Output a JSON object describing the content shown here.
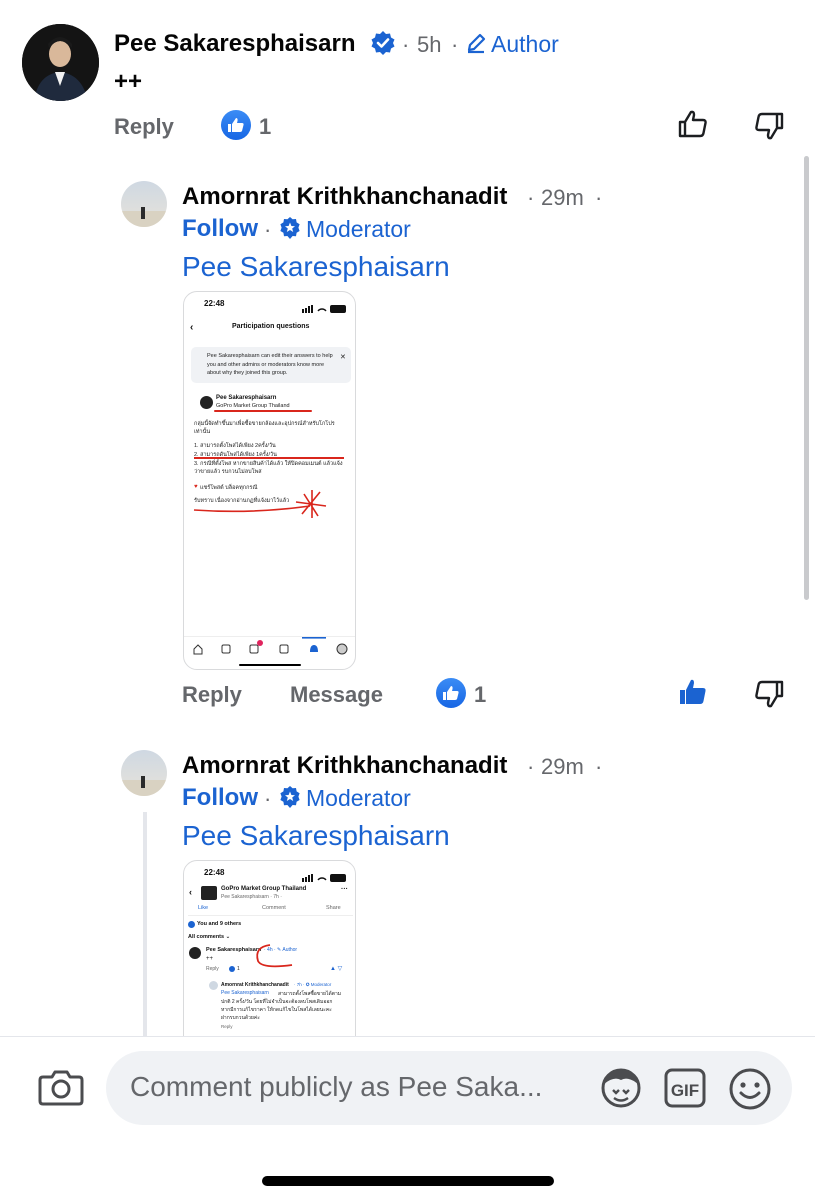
{
  "colors": {
    "accent": "#1b63d1",
    "muted": "#65676b",
    "like_gradient": "#1766e4"
  },
  "comment1": {
    "author": "Pee Sakaresphaisarn",
    "verified_icon": "verified-badge-icon",
    "time": "5h",
    "role": "Author",
    "text": "++",
    "reply_label": "Reply",
    "like_count": "1"
  },
  "reply1": {
    "author": "Amornrat Krithkhanchanadit",
    "time": "29m",
    "follow_label": "Follow",
    "role": "Moderator",
    "mention": "Pee Sakaresphaisarn",
    "reply_label": "Reply",
    "message_label": "Message",
    "like_count": "1",
    "screenshot": {
      "time": "22:48",
      "battery": "100",
      "title": "Participation questions",
      "notice": "Pee Sakaresphaisarn can edit their answers to help you and other admins or moderators know more about why they joined this group.",
      "member_name": "Pee Sakaresphaisarn",
      "member_group": "GoPro Market  Group Thailand",
      "rules_intro": "กลุ่มนี้จัดทำขึ้นมาเพื่อซื้อขายกล้องและอุปกรณ์สำหรับโกโปร เท่านั้น",
      "rule1": "1. สามารถตั้งโพสได้เพียง 2ครั้ง/วัน",
      "rule2": "2. สามารถดันโพสได้เพียง 1ครั้ง/วัน",
      "rule3": "3. กรณีที่ตั้งโพส หากขายสินค้าได้แล้ว ให้ปิดคอมเมนต์ แล้วแจ้งว่าขายแล้ว รบกวนไม่ลบโพส",
      "heart_line": "แชร์โพสต์ บล็อคทุกกรณี",
      "answer": "รับทราบ เนื่องจากอ่านกฏที่แจ้งมาไว้แล้ว",
      "nav_badge": "2"
    }
  },
  "reply2": {
    "author": "Amornrat Krithkhanchanadit",
    "time": "29m",
    "follow_label": "Follow",
    "role": "Moderator",
    "mention": "Pee Sakaresphaisarn",
    "screenshot": {
      "time": "22:48",
      "battery": "100",
      "group_name": "GoPro Market  Group Thailand",
      "group_sub": "Pee Sakaresphaisarn · 7h ·",
      "like": "Like",
      "comment": "Comment",
      "share": "Share",
      "reactions": "You and 9 others",
      "all_comments": "All comments ⌄",
      "c_author": "Pee Sakaresphaisarn",
      "c_meta": "· 4h · ✎ Author",
      "c_text": "++",
      "c_reply": "Reply",
      "c_likes": "1",
      "r_author": "Amornrat Krithkhanchanadit",
      "r_meta": "· 7h · ✪ Moderator",
      "r_mention": "Pee Sakaresphaisarn",
      "r_text1": "สามารถตั้งโพสซื้อขายได้ตาม",
      "r_text2": "ปกติ 2 ครั้ง/วัน โดยที่ไม่จำเป็นจะต้องลบโพสเดิมออก",
      "r_text3": "หากมีการแก้ไขราคา ให้กดแก้ไขในโพสได้เลยนะคะ",
      "r_text4": "ฝากรบกวนด้วยค่ะ",
      "r_reply": "Reply"
    }
  },
  "composer": {
    "placeholder": "Comment publicly as Pee Saka..."
  }
}
